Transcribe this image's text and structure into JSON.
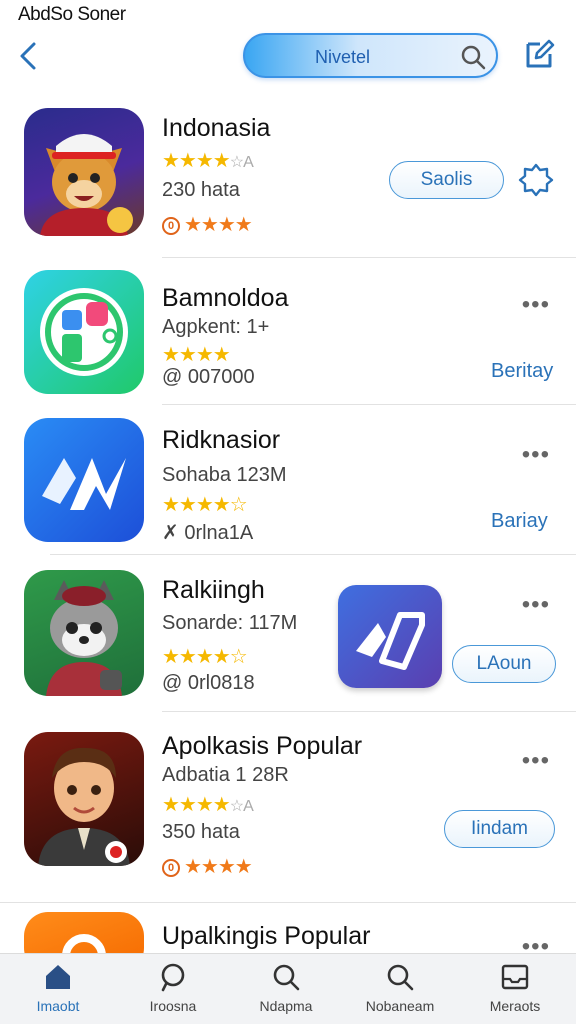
{
  "status_bar": {
    "text": "AbdSo Soner"
  },
  "header": {
    "search_label": "Nivetel"
  },
  "apps": [
    {
      "name": "Indonasia",
      "stars": "★★★★",
      "stars_tail": "☆A",
      "size": "230 hata",
      "rating_icon": "0",
      "rating": "★★★★",
      "action": "Saolis"
    },
    {
      "name": "Bamnoldoa",
      "subtitle": "Agpkent: 1+",
      "stars": "★★★★",
      "downloads": "@ 007000",
      "action": "Beritay"
    },
    {
      "name": "Ridknasior",
      "subtitle": "Sohaba 123M",
      "stars": "★★★★",
      "stars_tail": "☆",
      "downloads": "✗ 0rlna1A",
      "action": "Bariay"
    },
    {
      "name": "Ralkiingh",
      "subtitle": "Sonarde: 117M",
      "stars": "★★★★",
      "stars_tail": "☆",
      "downloads": "@ 0rl0818",
      "action": "LAoun"
    },
    {
      "name": "Apolkasis Popular",
      "subtitle": "Adbatia 1 28R",
      "stars": "★★★★",
      "stars_tail": "☆A",
      "size": "350 hata",
      "rating_icon": "0",
      "rating": "★★★★",
      "action": "Iindam"
    },
    {
      "name": "Upalkingis Popular"
    }
  ],
  "tabs": [
    {
      "label": "Imaobt",
      "icon": "home-icon"
    },
    {
      "label": "Iroosna",
      "icon": "search-icon"
    },
    {
      "label": "Ndapma",
      "icon": "search-icon"
    },
    {
      "label": "Nobaneam",
      "icon": "search-icon"
    },
    {
      "label": "Meraots",
      "icon": "inbox-icon"
    }
  ],
  "colors": {
    "accent": "#2a72b8",
    "star": "#f5b800",
    "star_orange": "#f07a1a"
  }
}
